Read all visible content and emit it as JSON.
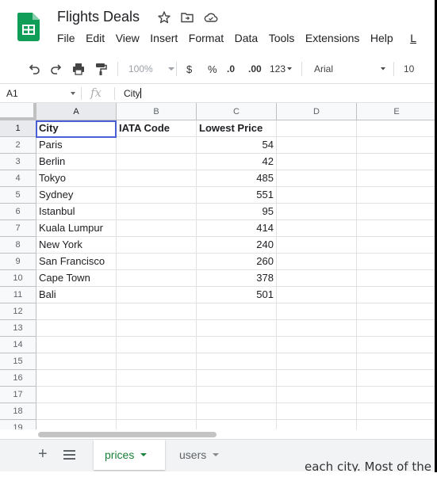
{
  "document": {
    "title": "Flights Deals",
    "menu": [
      "File",
      "Edit",
      "View",
      "Insert",
      "Format",
      "Data",
      "Tools",
      "Extensions",
      "Help",
      "L"
    ]
  },
  "toolbar": {
    "zoom": "100%",
    "currency": "$",
    "percent": "%",
    "decrease_decimal": ".0",
    "increase_decimal": ".00",
    "number_format": "123",
    "font": "Arial",
    "font_size": "10"
  },
  "formula_bar": {
    "name_box": "A1",
    "fx": "fx",
    "value": "City"
  },
  "columns": [
    "A",
    "B",
    "C",
    "D",
    "E"
  ],
  "rows": [
    "1",
    "2",
    "3",
    "4",
    "5",
    "6",
    "7",
    "8",
    "9",
    "10",
    "11",
    "12",
    "13",
    "14",
    "15",
    "16",
    "17",
    "18",
    "19"
  ],
  "table": {
    "headers": [
      "City",
      "IATA Code",
      "Lowest Price"
    ],
    "data": [
      [
        "Paris",
        "",
        "54"
      ],
      [
        "Berlin",
        "",
        "42"
      ],
      [
        "Tokyo",
        "",
        "485"
      ],
      [
        "Sydney",
        "",
        "551"
      ],
      [
        "Istanbul",
        "",
        "95"
      ],
      [
        "Kuala Lumpur",
        "",
        "414"
      ],
      [
        "New York",
        "",
        "240"
      ],
      [
        "San Francisco",
        "",
        "260"
      ],
      [
        "Cape Town",
        "",
        "378"
      ],
      [
        "Bali",
        "",
        "501"
      ]
    ]
  },
  "sheets": {
    "active": "prices",
    "other": "users"
  },
  "background_text": "each city. Most of the",
  "colors": {
    "accent_green": "#188038",
    "selection_blue": "#4a5fd6",
    "logo_green": "#0f9d58"
  }
}
